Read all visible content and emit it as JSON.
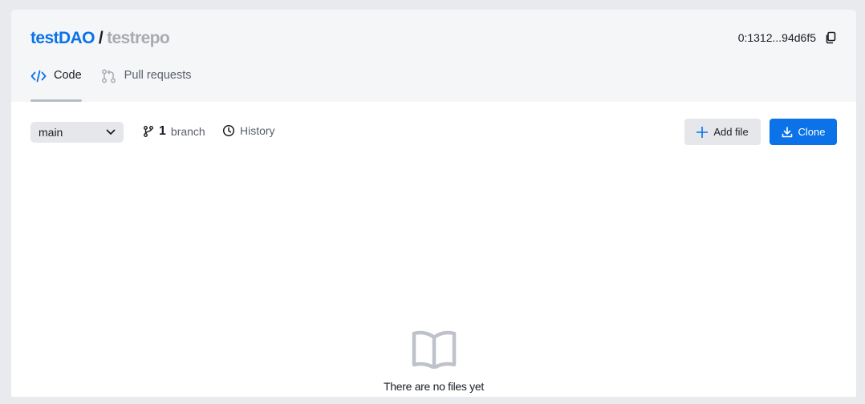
{
  "header": {
    "org": "testDAO",
    "separator": "/",
    "repo": "testrepo",
    "address": "0:1312...94d6f5"
  },
  "tabs": [
    {
      "label": "Code",
      "icon": "code-icon",
      "active": true
    },
    {
      "label": "Pull requests",
      "icon": "pull-request-icon",
      "active": false
    }
  ],
  "toolbar": {
    "branch_selected": "main",
    "branch_count": "1",
    "branch_label": "branch",
    "history_label": "History",
    "add_file_label": "Add file",
    "clone_label": "Clone"
  },
  "empty_state": {
    "icon": "book-icon",
    "message": "There are no files yet"
  },
  "colors": {
    "accent": "#0b72e7",
    "muted": "#a9abb2",
    "background": "#e9eaee"
  }
}
